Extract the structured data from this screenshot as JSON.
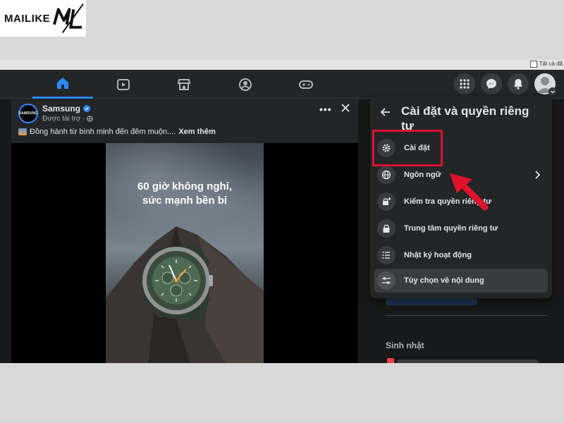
{
  "watermark": {
    "brand": "MAILIKE",
    "mark": "ML"
  },
  "browser": {
    "top_strip_text": "Tất cả đã"
  },
  "navbar": {
    "tabs": [
      {
        "name": "home",
        "icon": "home-icon",
        "active": true
      },
      {
        "name": "reels",
        "icon": "video-icon",
        "active": false
      },
      {
        "name": "marketplace",
        "icon": "store-icon",
        "active": false
      },
      {
        "name": "groups",
        "icon": "groups-icon",
        "active": false
      },
      {
        "name": "gaming",
        "icon": "gamepad-icon",
        "active": false
      }
    ],
    "right_buttons": [
      "grid-menu-icon",
      "messenger-icon",
      "bell-icon",
      "profile-avatar"
    ],
    "accent_color": "#2d88ff"
  },
  "post": {
    "author": "Samsung",
    "avatar_text": "SAMSUNG",
    "sponsored_label": "Được tài trợ ·",
    "text": "Đồng hành từ bình minh đến đêm muộn....",
    "see_more": "Xem thêm",
    "ad_headline_line1": "60 giờ không nghỉ,",
    "ad_headline_line2": "sức mạnh bền bỉ"
  },
  "menu": {
    "title": "Cài đặt và quyền riêng tư",
    "items": [
      {
        "label": "Cài đặt",
        "icon": "gear-icon"
      },
      {
        "label": "Ngôn ngữ",
        "icon": "globe-icon",
        "has_submenu": true
      },
      {
        "label": "Kiểm tra quyền riêng tư",
        "icon": "lock-plus-icon"
      },
      {
        "label": "Trung tâm quyền riêng tư",
        "icon": "lock-icon"
      },
      {
        "label": "Nhật ký hoạt động",
        "icon": "list-icon"
      },
      {
        "label": "Tùy chọn về nội dung",
        "icon": "sliders-icon",
        "hovered": true
      }
    ]
  },
  "sidebar": {
    "birthday_title": "Sinh nhật"
  },
  "annotation": {
    "highlight_color": "#e0112b"
  }
}
